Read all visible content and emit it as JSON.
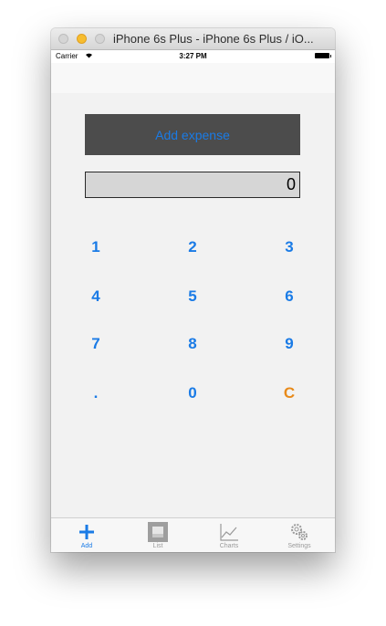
{
  "window": {
    "title": "iPhone 6s Plus - iPhone 6s Plus / iO..."
  },
  "status_bar": {
    "carrier": "Carrier",
    "time": "3:27 PM"
  },
  "main": {
    "add_expense_label": "Add expense",
    "amount_value": "0"
  },
  "keypad": {
    "k1": "1",
    "k2": "2",
    "k3": "3",
    "k4": "4",
    "k5": "5",
    "k6": "6",
    "k7": "7",
    "k8": "8",
    "k9": "9",
    "kdot": ".",
    "k0": "0",
    "kclear": "C"
  },
  "tabs": {
    "add": "Add",
    "list": "List",
    "charts": "Charts",
    "settings": "Settings"
  },
  "colors": {
    "accent": "#1a7be6",
    "clear_key": "#e88a1a",
    "button_bg": "#4c4c4c",
    "amount_bg": "#d6d6d6"
  },
  "icons": {
    "add": "plus-icon",
    "list": "list-square-icon",
    "charts": "line-chart-icon",
    "settings": "gears-icon"
  }
}
